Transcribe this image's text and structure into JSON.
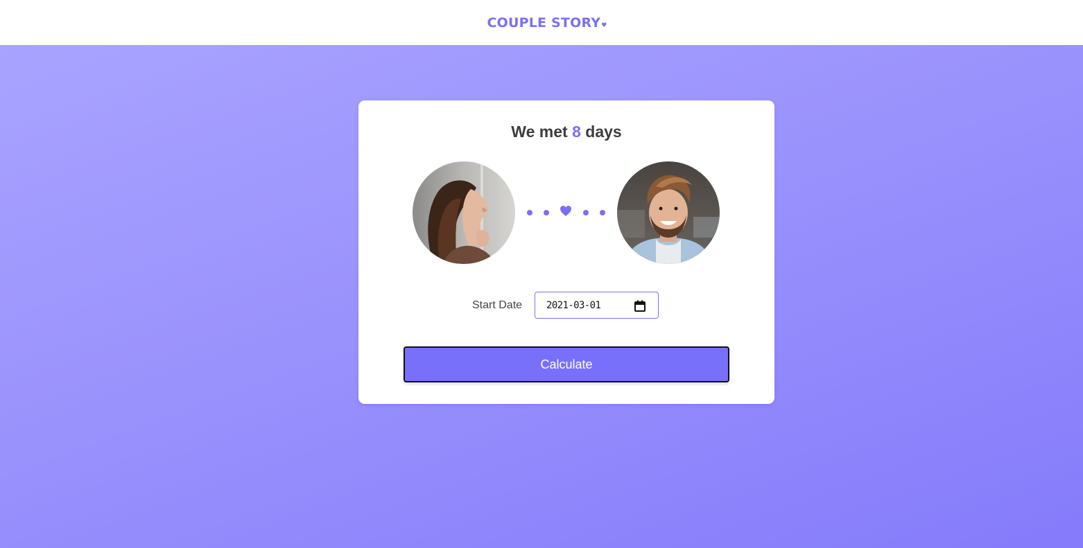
{
  "header": {
    "logo_text": "COUPLE STORY",
    "logo_heart": "♥"
  },
  "card": {
    "title_prefix": "We met",
    "days_count": "8",
    "title_suffix": "days",
    "avatars": [
      {
        "name": "avatar-woman",
        "description_icon": "woman-photo"
      },
      {
        "name": "avatar-man",
        "description_icon": "man-photo"
      }
    ],
    "connector_icon": "heart-icon",
    "start_date_label": "Start Date",
    "start_date_value": "2021-03-01",
    "calendar_icon": "calendar-icon",
    "calculate_label": "Calculate"
  },
  "colors": {
    "accent": "#7a6ff5",
    "button": "#7870fb",
    "bg_gradient_start": "#a9a3ff",
    "bg_gradient_end": "#857bfb"
  }
}
